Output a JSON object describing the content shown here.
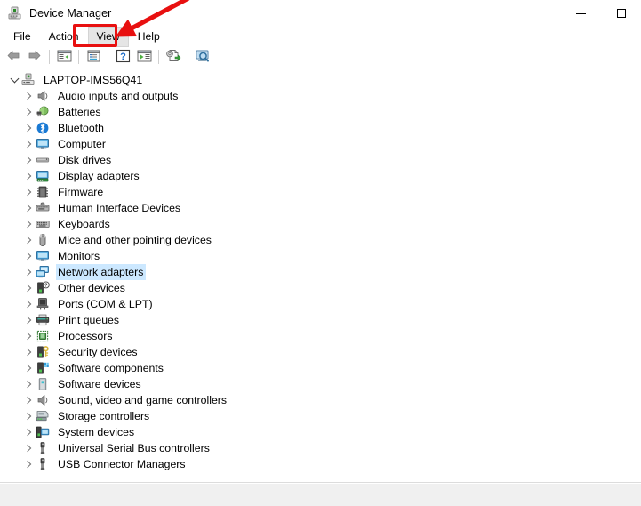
{
  "window": {
    "title": "Device Manager",
    "app_icon": "device-manager-icon"
  },
  "caption": {
    "minimize_label": "Minimize",
    "maximize_label": "Maximize"
  },
  "menubar": {
    "items": [
      {
        "label": "File",
        "state": "normal"
      },
      {
        "label": "Action",
        "state": "normal"
      },
      {
        "label": "View",
        "state": "hovered"
      },
      {
        "label": "Help",
        "state": "normal"
      }
    ]
  },
  "toolbar": {
    "buttons": [
      {
        "name": "back-arrow-icon",
        "tooltip": "Back"
      },
      {
        "name": "forward-arrow-icon",
        "tooltip": "Forward"
      },
      {
        "name": "separator-1",
        "tooltip": ""
      },
      {
        "name": "show-hide-console-tree-icon",
        "tooltip": "Show/Hide Console Tree"
      },
      {
        "name": "separator-2",
        "tooltip": ""
      },
      {
        "name": "properties-icon",
        "tooltip": "Properties"
      },
      {
        "name": "separator-3",
        "tooltip": ""
      },
      {
        "name": "help-icon",
        "tooltip": "Help"
      },
      {
        "name": "show-hide-action-pane-icon",
        "tooltip": "Show/Hide Action Pane"
      },
      {
        "name": "separator-4",
        "tooltip": ""
      },
      {
        "name": "update-driver-icon",
        "tooltip": "Update Driver Software"
      },
      {
        "name": "separator-5",
        "tooltip": ""
      },
      {
        "name": "scan-for-hardware-changes-icon",
        "tooltip": "Scan for hardware changes"
      }
    ]
  },
  "tree": {
    "root": {
      "label": "LAPTOP-IMS56Q41",
      "icon": "computer-node-icon",
      "expanded": true
    },
    "items": [
      {
        "label": "Audio inputs and outputs",
        "icon": "speaker-icon",
        "selected": false
      },
      {
        "label": "Batteries",
        "icon": "battery-icon",
        "selected": false
      },
      {
        "label": "Bluetooth",
        "icon": "bluetooth-icon",
        "selected": false
      },
      {
        "label": "Computer",
        "icon": "monitor-icon",
        "selected": false
      },
      {
        "label": "Disk drives",
        "icon": "disk-drive-icon",
        "selected": false
      },
      {
        "label": "Display adapters",
        "icon": "display-adapter-icon",
        "selected": false
      },
      {
        "label": "Firmware",
        "icon": "firmware-chip-icon",
        "selected": false
      },
      {
        "label": "Human Interface Devices",
        "icon": "hid-icon",
        "selected": false
      },
      {
        "label": "Keyboards",
        "icon": "keyboard-icon",
        "selected": false
      },
      {
        "label": "Mice and other pointing devices",
        "icon": "mouse-icon",
        "selected": false
      },
      {
        "label": "Monitors",
        "icon": "monitor-icon",
        "selected": false
      },
      {
        "label": "Network adapters",
        "icon": "network-adapter-icon",
        "selected": true
      },
      {
        "label": "Other devices",
        "icon": "unknown-device-icon",
        "selected": false
      },
      {
        "label": "Ports (COM & LPT)",
        "icon": "port-icon",
        "selected": false
      },
      {
        "label": "Print queues",
        "icon": "printer-icon",
        "selected": false
      },
      {
        "label": "Processors",
        "icon": "processor-icon",
        "selected": false
      },
      {
        "label": "Security devices",
        "icon": "security-key-icon",
        "selected": false
      },
      {
        "label": "Software components",
        "icon": "software-component-icon",
        "selected": false
      },
      {
        "label": "Software devices",
        "icon": "software-device-icon",
        "selected": false
      },
      {
        "label": "Sound, video and game controllers",
        "icon": "speaker-icon",
        "selected": false
      },
      {
        "label": "Storage controllers",
        "icon": "storage-controller-icon",
        "selected": false
      },
      {
        "label": "System devices",
        "icon": "system-device-icon",
        "selected": false
      },
      {
        "label": "Universal Serial Bus controllers",
        "icon": "usb-icon",
        "selected": false
      },
      {
        "label": "USB Connector Managers",
        "icon": "usb-icon",
        "selected": false
      }
    ]
  },
  "statusbar": {
    "panes": [
      "",
      "",
      ""
    ]
  },
  "annotations": {
    "highlight_color": "#e81010",
    "rect": {
      "target": "View"
    },
    "arrow": {
      "points_to": "View"
    }
  },
  "colors": {
    "selection": "#cce8ff",
    "annotation_red": "#e81010",
    "statusbar_bg": "#f0f0f0"
  }
}
